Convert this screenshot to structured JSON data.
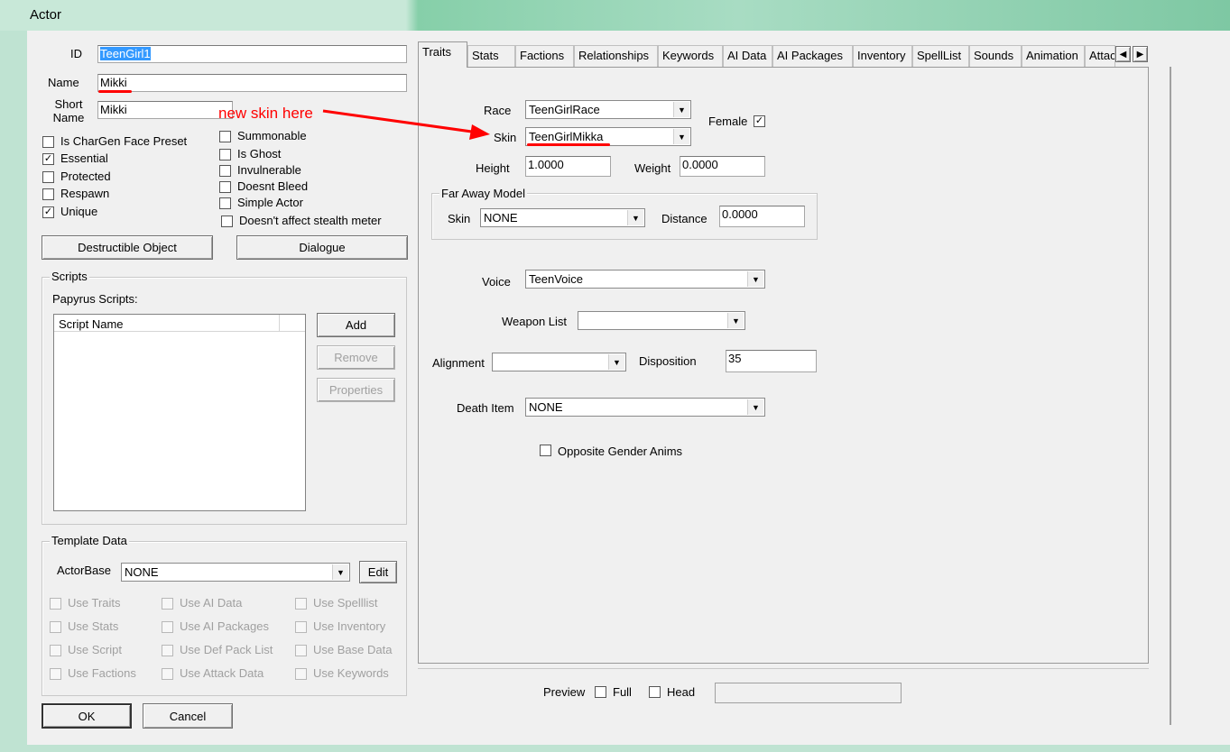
{
  "window": {
    "title": "Actor"
  },
  "left": {
    "id_label": "ID",
    "id_value": "TeenGirl1",
    "name_label": "Name",
    "name_value": "Mikki",
    "short_name_label": "Short\nName",
    "short_name_value": "Mikki",
    "flags_left": [
      {
        "label": "Is CharGen Face Preset",
        "checked": false
      },
      {
        "label": "Essential",
        "checked": true
      },
      {
        "label": "Protected",
        "checked": false
      },
      {
        "label": "Respawn",
        "checked": false
      },
      {
        "label": "Unique",
        "checked": true
      }
    ],
    "flags_right": [
      {
        "label": "Summonable",
        "checked": false
      },
      {
        "label": "Is Ghost",
        "checked": false
      },
      {
        "label": "Invulnerable",
        "checked": false
      },
      {
        "label": "Doesnt Bleed",
        "checked": false
      },
      {
        "label": "Simple Actor",
        "checked": false
      },
      {
        "label": "Doesn't affect stealth meter",
        "checked": false
      }
    ],
    "destructible_button": "Destructible Object",
    "dialogue_button": "Dialogue",
    "scripts": {
      "group_title": "Scripts",
      "papyrus_label": "Papyrus Scripts:",
      "column_header": "Script Name",
      "add": "Add",
      "remove": "Remove",
      "properties": "Properties"
    },
    "template": {
      "group_title": "Template Data",
      "actorbase_label": "ActorBase",
      "actorbase_value": "NONE",
      "edit": "Edit",
      "uses": [
        [
          "Use Traits",
          "Use AI Data",
          "Use Spelllist"
        ],
        [
          "Use Stats",
          "Use AI Packages",
          "Use Inventory"
        ],
        [
          "Use Script",
          "Use Def Pack List",
          "Use Base Data"
        ],
        [
          "Use Factions",
          "Use Attack Data",
          "Use Keywords"
        ]
      ]
    },
    "ok": "OK",
    "cancel": "Cancel"
  },
  "tabs": [
    "Traits",
    "Stats",
    "Factions",
    "Relationships",
    "Keywords",
    "AI Data",
    "AI Packages",
    "Inventory",
    "SpellList",
    "Sounds",
    "Animation",
    "Attac"
  ],
  "traits": {
    "race_label": "Race",
    "race_value": "TeenGirlRace",
    "female_label": "Female",
    "female_checked": true,
    "skin_label": "Skin",
    "skin_value": "TeenGirlMikka",
    "height_label": "Height",
    "height_value": "1.0000",
    "weight_label": "Weight",
    "weight_value": "0.0000",
    "far_away": {
      "group_title": "Far Away Model",
      "skin_label": "Skin",
      "skin_value": "NONE",
      "distance_label": "Distance",
      "distance_value": "0.0000"
    },
    "voice_label": "Voice",
    "voice_value": "TeenVoice",
    "weapon_list_label": "Weapon List",
    "weapon_list_value": "",
    "alignment_label": "Alignment",
    "alignment_value": "",
    "disposition_label": "Disposition",
    "disposition_value": "35",
    "death_item_label": "Death Item",
    "death_item_value": "NONE",
    "opposite_gender_label": "Opposite Gender Anims"
  },
  "preview": {
    "label": "Preview",
    "full": "Full",
    "head": "Head"
  },
  "annotation": {
    "text": "new skin here",
    "color": "#ff0000"
  }
}
